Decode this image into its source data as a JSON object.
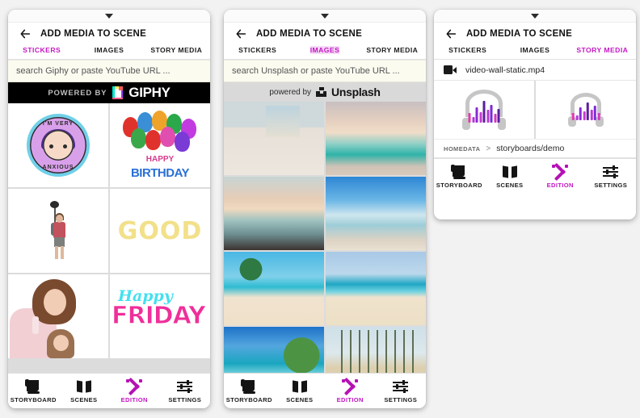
{
  "colors": {
    "accent": "#c317c3",
    "accent_icon": "#b512b5",
    "panel_bg": "#ffffff",
    "page_bg": "#f2f2f2",
    "search_bg": "#fbfbf0",
    "giphy_banner_bg": "#000000",
    "unsplash_banner_bg": "#d9d9d9"
  },
  "panels": [
    {
      "id": "stickers",
      "title": "ADD MEDIA TO SCENE",
      "back_icon": "back-arrow-icon",
      "handle_icon": "chevron-down-icon",
      "tabs": [
        {
          "label": "STICKERS",
          "active": true
        },
        {
          "label": "IMAGES",
          "active": false
        },
        {
          "label": "STORY MEDIA",
          "active": false
        }
      ],
      "search": {
        "placeholder": "search Giphy or paste YouTube URL ...",
        "value": ""
      },
      "banner": {
        "prefix": "POWERED BY",
        "brand": "GIPHY",
        "logo_icon": "giphy-logo-icon"
      },
      "items": [
        {
          "kind": "sticker",
          "name": "im-very-anxious-sticker",
          "top_text": "I'M VERY",
          "bottom_text": "ANXIOUS"
        },
        {
          "kind": "sticker",
          "name": "happy-birthday-balloons-sticker",
          "line1": "HAPPY",
          "line2": "BIRTHDAY"
        },
        {
          "kind": "sticker",
          "name": "hiker-selfie-stick-sticker",
          "label": ""
        },
        {
          "kind": "sticker",
          "name": "good-text-sticker",
          "label": "GOOD"
        },
        {
          "kind": "sticker",
          "name": "woman-with-baby-sticker",
          "label": ""
        },
        {
          "kind": "sticker",
          "name": "happy-friday-sticker",
          "line1": "Happy",
          "line2": "FRIDAY"
        }
      ]
    },
    {
      "id": "images",
      "title": "ADD MEDIA TO SCENE",
      "back_icon": "back-arrow-icon",
      "handle_icon": "chevron-down-icon",
      "tabs": [
        {
          "label": "STICKERS",
          "active": false
        },
        {
          "label": "IMAGES",
          "active": true
        },
        {
          "label": "STORY MEDIA",
          "active": false
        }
      ],
      "search": {
        "placeholder": "search Unsplash or paste YouTube URL ...",
        "value": ""
      },
      "banner": {
        "prefix": "powered by",
        "brand": "Unsplash",
        "logo_icon": "unsplash-logo-icon"
      },
      "items": [
        {
          "kind": "photo",
          "name": "photo-bedroom-beach-view",
          "style": "ph-bedroom"
        },
        {
          "kind": "photo",
          "name": "photo-sunset-shoreline",
          "style": "ph-sunsetbeach"
        },
        {
          "kind": "photo",
          "name": "photo-dusk-waves",
          "style": "ph-dusk"
        },
        {
          "kind": "photo",
          "name": "photo-blue-sky-sunset-beach",
          "style": "ph-bluesky"
        },
        {
          "kind": "photo",
          "name": "photo-palm-tree-parasol-beach",
          "style": "ph-palms"
        },
        {
          "kind": "photo",
          "name": "photo-empty-sand-and-sea",
          "style": "ph-sandsea"
        },
        {
          "kind": "photo",
          "name": "photo-palm-over-lagoon",
          "style": "ph-lagoon"
        },
        {
          "kind": "photo",
          "name": "photo-palm-lined-boardwalk",
          "style": "ph-boardwalk"
        }
      ]
    },
    {
      "id": "story",
      "title": "ADD MEDIA TO SCENE",
      "back_icon": "back-arrow-icon",
      "handle_icon": "chevron-down-icon",
      "tabs": [
        {
          "label": "STICKERS",
          "active": false
        },
        {
          "label": "IMAGES",
          "active": false
        },
        {
          "label": "STORY MEDIA",
          "active": true
        }
      ],
      "files": [
        {
          "name": "video-wall-static.mp4",
          "icon": "video-camera-icon"
        }
      ],
      "audio_items": [
        {
          "name": "audio-thumbnail-1",
          "icon": "headphones-waveform-icon"
        },
        {
          "name": "audio-thumbnail-2",
          "icon": "headphones-waveform-icon"
        }
      ],
      "breadcrumb": {
        "root": "HOMEDATA",
        "separator": ">",
        "path": "storyboards/demo"
      }
    }
  ],
  "bottom_nav": [
    {
      "label": "STORYBOARD",
      "icon": "storyboard-icon",
      "active": false
    },
    {
      "label": "SCENES",
      "icon": "scenes-map-icon",
      "active": false
    },
    {
      "label": "EDITION",
      "icon": "edition-magic-wand-icon",
      "active": true
    },
    {
      "label": "SETTINGS",
      "icon": "settings-sliders-icon",
      "active": false
    }
  ]
}
